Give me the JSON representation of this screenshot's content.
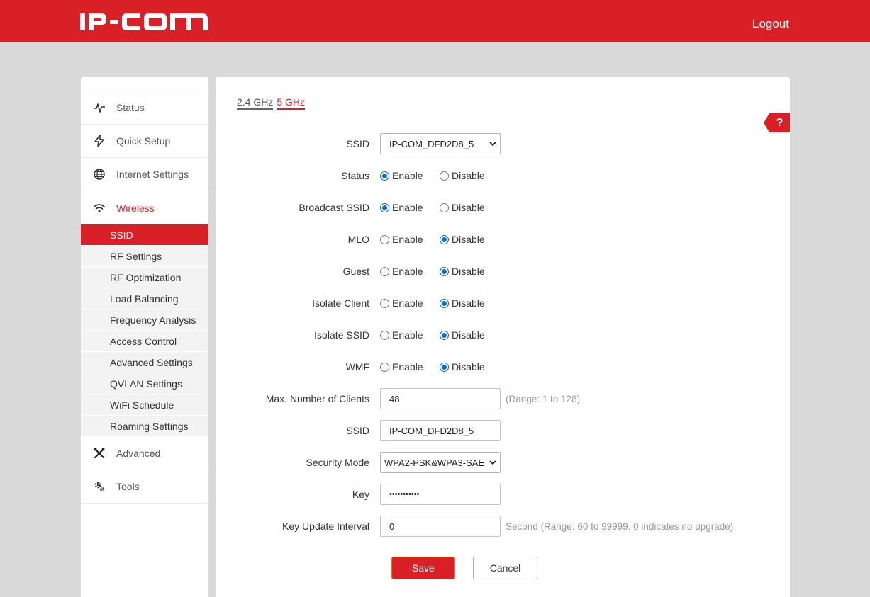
{
  "header": {
    "logo_text": "IP-COM",
    "logout_label": "Logout"
  },
  "colors": {
    "brand_red": "#d92027",
    "radio_blue": "#0a6ed1"
  },
  "sidebar": {
    "items": [
      {
        "label": "Status",
        "icon": "pulse-icon"
      },
      {
        "label": "Quick Setup",
        "icon": "lightning-icon"
      },
      {
        "label": "Internet Settings",
        "icon": "globe-icon"
      },
      {
        "label": "Wireless",
        "icon": "wifi-icon",
        "active": true
      }
    ],
    "wireless_sub": [
      "SSID",
      "RF Settings",
      "RF Optimization",
      "Load Balancing",
      "Frequency Analysis",
      "Access Control",
      "Advanced Settings",
      "QVLAN Settings",
      "WiFi Schedule",
      "Roaming Settings"
    ],
    "bottom_items": [
      {
        "label": "Advanced",
        "icon": "tools-cross-icon"
      },
      {
        "label": "Tools",
        "icon": "gears-icon"
      }
    ]
  },
  "tabs": {
    "band_24": "2.4 GHz",
    "band_5": "5 GHz",
    "active": "5 GHz"
  },
  "help_label": "?",
  "form": {
    "ssid_select": {
      "label": "SSID",
      "value": "IP-COM_DFD2D8_5"
    },
    "enable_label": "Enable",
    "disable_label": "Disable",
    "radios": [
      {
        "label": "Status",
        "selected": "Enable"
      },
      {
        "label": "Broadcast SSID",
        "selected": "Enable"
      },
      {
        "label": "MLO",
        "selected": "Disable"
      },
      {
        "label": "Guest",
        "selected": "Disable"
      },
      {
        "label": "Isolate Client",
        "selected": "Disable"
      },
      {
        "label": "Isolate SSID",
        "selected": "Disable"
      },
      {
        "label": "WMF",
        "selected": "Disable"
      }
    ],
    "max_clients": {
      "label": "Max. Number of Clients",
      "value": "48",
      "hint": "(Range: 1 to 128)"
    },
    "ssid_name": {
      "label": "SSID",
      "value": "IP-COM_DFD2D8_5"
    },
    "security_mode": {
      "label": "Security Mode",
      "value": "WPA2-PSK&WPA3-SAE"
    },
    "key": {
      "label": "Key",
      "value": "•••••••••••"
    },
    "key_interval": {
      "label": "Key Update Interval",
      "value": "0",
      "hint": "Second (Range: 60 to 99999. 0 indicates no upgrade)"
    }
  },
  "buttons": {
    "save": "Save",
    "cancel": "Cancel"
  }
}
